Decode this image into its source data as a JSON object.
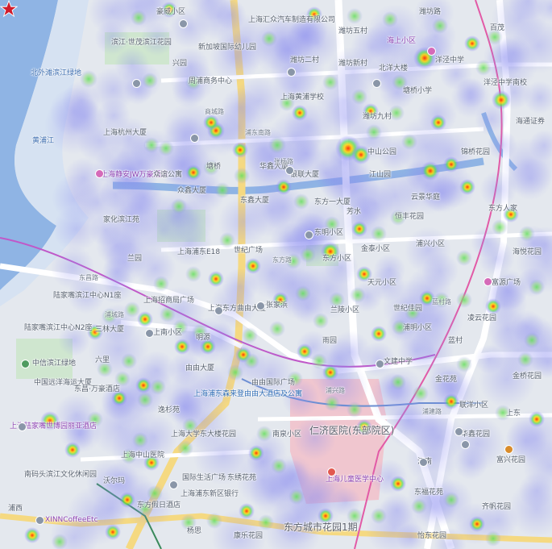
{
  "labels": {
    "riverside_north": "滨江·世茂滨江花园",
    "riverside_west": "北外滩滨江绿地",
    "huangpu_river": "黄浦江",
    "lujiazui_binjiang": "陆家嘴滨江中心N1座",
    "lujiazui_binjiang2": "陆家嘴滨江中心N2座",
    "zhongxin_greenland": "中信滨江绿地",
    "haiyun_building": "中国远洋海运大厦",
    "dongchang_marriott": "东昌·万豪酒店",
    "lujiazui_shibo": "上海陆家嘴世博园丽亚酒店",
    "nanxi_culture": "南码头滨江文化休闲园",
    "xinn": "XINNCoffeeEtc",
    "jiahua": "家化滨江苑",
    "lanyuan": "兰园",
    "shanghai_jianshe": "上海浦东E18",
    "shanghai_shangjian": "上海招商局广场",
    "mingyuan": "明源",
    "yuyuan": "上海东方曲由大厦",
    "youyou_building": "由由大厦",
    "marker_caption": "上海浦东森来登由由大酒店及公寓",
    "youyou_intl": "由由国际广场",
    "renji": "仁济医院(东部院区)",
    "children_center": "上海儿童医学中心",
    "dongfang_city": "东方城市花园1期",
    "wenhua_middle": "文建中学",
    "nanquan": "南泉小区",
    "dongfang_road": "东方路",
    "pudong_road": "浦东南路",
    "weifang_road": "潍坊路",
    "zhangyang_road": "张杨路",
    "shangcheng_road": "商城路",
    "lancun_road": "蓝村路",
    "pujian_road": "浦建路",
    "dongchang_road": "东昌路",
    "pucheng_road": "浦城路",
    "weifang_xincun": "潍坊新村",
    "weifang_5": "潍坊五村",
    "weifang_2": "潍坊二村",
    "weifang_9": "潍坊九村",
    "beiyang": "北洋大楼",
    "yangjing_school": "洋泾中学",
    "haishang_xiaoqu": "海上小区",
    "shanhai_building": "上海汇众汽车制造有限公司",
    "xinjiapo": "新加坡国际幼儿园",
    "zhouqiao": "周浦商务中心",
    "dongfang_xiaoqu": "东方小区",
    "zhongyi": "众谊公寓",
    "zhongxin_building": "众鑫大厦",
    "huaxin_building": "华鑫大厦",
    "dongxin_building": "东鑫大厦",
    "yinlian": "银联大厦",
    "shanghai_jw": "上海静安JW万豪酒店",
    "zhanghe": "张家浜",
    "shiji_plaza": "世纪广场",
    "tangqiao": "塘桥",
    "jiangshan": "江山园",
    "puxing": "浦兴小区",
    "fangshui": "芳水",
    "dongfang_building": "东方一大厦",
    "tianyuan": "天元小区",
    "lanling": "兰陵小区",
    "shangnan": "上南小区",
    "puming": "浦明小区",
    "yuyuan2": "雨园",
    "jinhua": "金花苑",
    "sanlin": "三林大厦",
    "liuli": "六里",
    "shiji_jiayuan": "世纪佳园",
    "huangpu_school": "上海黄浦学校",
    "tangqiao_school": "塘桥小学",
    "jiangnan": "江南",
    "haiyue": "海悦花园",
    "fuyuan": "富源广场",
    "jintai": "金泰小区",
    "dongming": "东明小区",
    "baimao": "百茂",
    "zhongshan": "中山公园",
    "huaxin_plaza": "华鑫花园",
    "puxi": "浦西",
    "lianyang": "联洋小区",
    "shanghai_daxue": "上海大学东大楼花园",
    "shangdong": "上东",
    "dongxiu": "东绣花苑",
    "dongfu": "东福花苑",
    "yishan": "逸杉苑",
    "haowei": "豪威小区",
    "jinqiao": "金桥花园",
    "lingyun": "凌云花园",
    "yidong": "怡东花园",
    "haitong": "海通证券",
    "shanghai_hangzhou": "上海杭州大厦",
    "shanghai_zhongshan": "上海中山医院",
    "dongfang_hotel": "东方假日酒店",
    "yangsi": "杨思",
    "guoji": "国际生活广场",
    "woer": "沃尔玛",
    "kangle": "康乐花园",
    "qifan": "齐帆花园",
    "yunjing": "云景华庭",
    "hengfeng": "恒丰花园",
    "dongfang_ren": "东方人家",
    "lancun": "蓝村",
    "yangjing_school2": "洋泾中学南校",
    "shanghai_yuanjing": "上海浦东新区银行",
    "puxing_road": "浦兴路",
    "fuxing": "富兴花园",
    "jinqiao2": "锦桥花园",
    "xingyuan": "兴园"
  },
  "marker": {
    "name": "上海浦东森来登由由大酒店及公寓"
  }
}
